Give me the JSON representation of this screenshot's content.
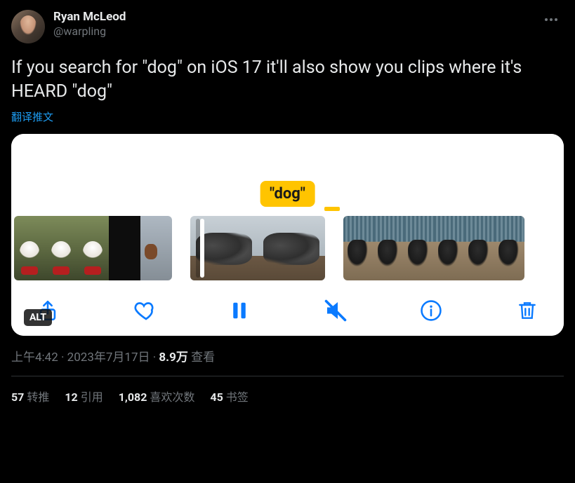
{
  "author": {
    "display_name": "Ryan McLeod",
    "handle": "@warpling"
  },
  "tweet_text": "If you search for \"dog\" on iOS 17 it'll also show you clips where it's HEARD \"dog\"",
  "translate_label": "翻译推文",
  "media": {
    "caption_label": "\"dog\"",
    "alt_badge": "ALT"
  },
  "timestamp": {
    "time": "上午4:42",
    "date": "2023年7月17日",
    "views_count": "8.9万",
    "views_suffix": "查看"
  },
  "stats": {
    "retweets_count": "57",
    "retweets_label": "转推",
    "quotes_count": "12",
    "quotes_label": "引用",
    "likes_count": "1,082",
    "likes_label": "喜欢次数",
    "bookmarks_count": "45",
    "bookmarks_label": "书签"
  }
}
